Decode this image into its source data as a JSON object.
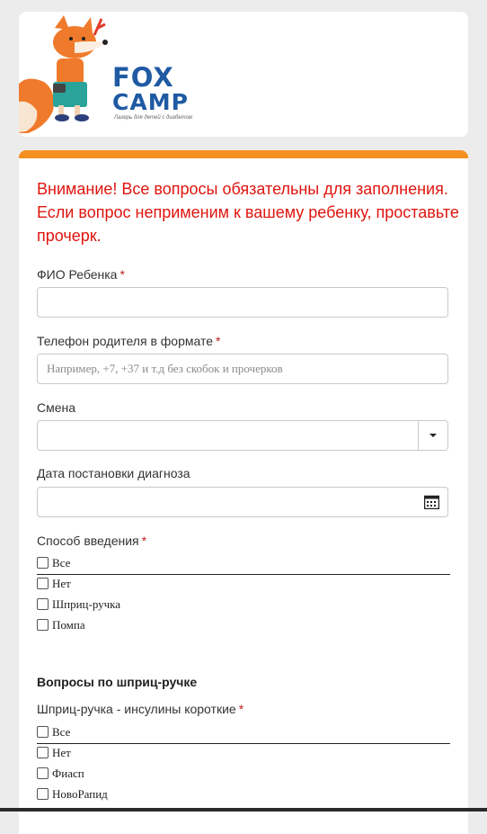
{
  "brand": {
    "word1": "FOX",
    "word2": "CAMP",
    "tagline": "Лагерь для детей с диабетом"
  },
  "colors": {
    "accent": "#f5901e",
    "notice": "#e0150f",
    "brand_blue": "#1f5aa3",
    "required": "#c11c1c"
  },
  "form": {
    "notice": "Внимание! Все вопросы обязательны для заполнения. Если вопрос неприменим к вашему ребенку, проставьте прочерк.",
    "required_mark": "*",
    "child_name": {
      "label": "ФИО Ребенка",
      "value": ""
    },
    "parent_phone": {
      "label": "Телефон родителя в формате",
      "placeholder": "Например, +7, +37 и т.д без скобок и прочерков",
      "value": ""
    },
    "shift": {
      "label": "Смена",
      "selected": ""
    },
    "diagnosis_date": {
      "label": "Дата постановки диагноза",
      "value": "",
      "icon": "calendar-icon"
    },
    "admin_method": {
      "label": "Способ введения",
      "options": [
        "Все",
        "Нет",
        "Шприц-ручка",
        "Помпа"
      ]
    },
    "pen_section": {
      "heading": "Вопросы по шприц-ручке",
      "short_insulins": {
        "label": "Шприц-ручка - инсулины короткие",
        "options": [
          "Все",
          "Нет",
          "Фиасп",
          "НовоРапид"
        ]
      }
    }
  }
}
